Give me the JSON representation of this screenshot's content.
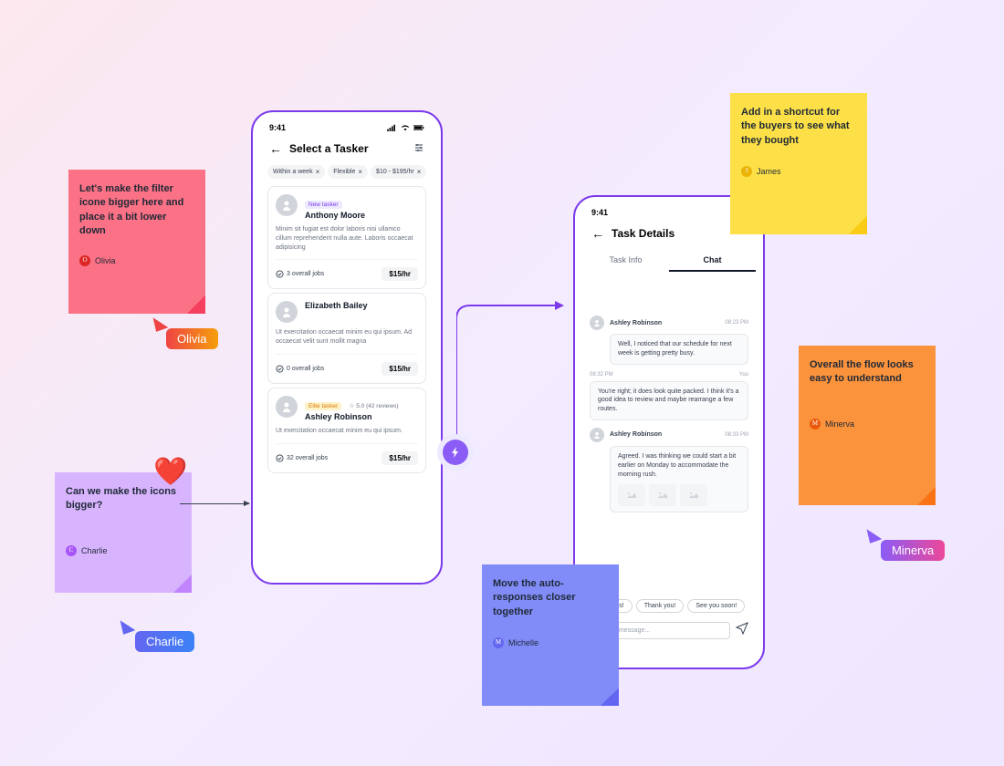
{
  "statusTime": "9:41",
  "phone1": {
    "title": "Select a Tasker",
    "chips": [
      "Within a week",
      "Flexible",
      "$10 - $195/hr"
    ],
    "taskers": [
      {
        "badge": "New tasker",
        "name": "Anthony Moore",
        "desc": "Minim sit fugiat est dolor laboris nisi ullamco cillum reprehenderit nulla aute. Laboris occaecat adipisicing",
        "jobs": "3 overall jobs",
        "price": "$15/hr"
      },
      {
        "badge": "",
        "name": "Elizabeth Bailey",
        "desc": "Ut exercitation occaecat minim eu qui ipsum. Ad occaecat velit sunt mollit magna",
        "jobs": "0 overall jobs",
        "price": "$15/hr"
      },
      {
        "badge": "Elite tasker",
        "rating": "5.0 (42 reviews)",
        "name": "Ashley Robinson",
        "desc": "Ut exercitation occaecat minim eu qui ipsum.",
        "jobs": "32 overall jobs",
        "price": "$15/hr"
      }
    ]
  },
  "phone2": {
    "title": "Task Details",
    "tabs": [
      "Task Info",
      "Chat"
    ],
    "messages": [
      {
        "name": "Ashley Robinson",
        "time": "08:23 PM",
        "text": "Well, I noticed that our schedule for next week is getting pretty busy."
      },
      {
        "timeLeft": "08:32 PM",
        "timeRight": "You",
        "text": "You're right; it does look quite packed. I think it's a good idea to review and maybe rearrange a few routes."
      },
      {
        "name": "Ashley Robinson",
        "time": "08:33 PM",
        "text": "Agreed. I was thinking we could start a bit earlier on Monday to accommodate the morning rush."
      }
    ],
    "quickReplies": [
      "Thanks!",
      "Thank you!",
      "See you soon!"
    ],
    "placeholder": "Type a message..."
  },
  "stickies": {
    "pink": {
      "text": "Let's make the filter icone bigger here and place it a bit lower down",
      "author": "Olivia"
    },
    "purple": {
      "text": "Can we make the icons bigger?",
      "author": "Charlie"
    },
    "yellow": {
      "text": "Add in a shortcut for the buyers to see what they bought",
      "author": "James"
    },
    "orange": {
      "text": "Overall the flow looks easy to understand",
      "author": "Minerva"
    },
    "blue": {
      "text": "Move the auto-responses closer together",
      "author": "Michelle"
    }
  },
  "cursors": {
    "olivia": "Olivia",
    "charlie": "Charlie",
    "minerva": "Minerva"
  }
}
